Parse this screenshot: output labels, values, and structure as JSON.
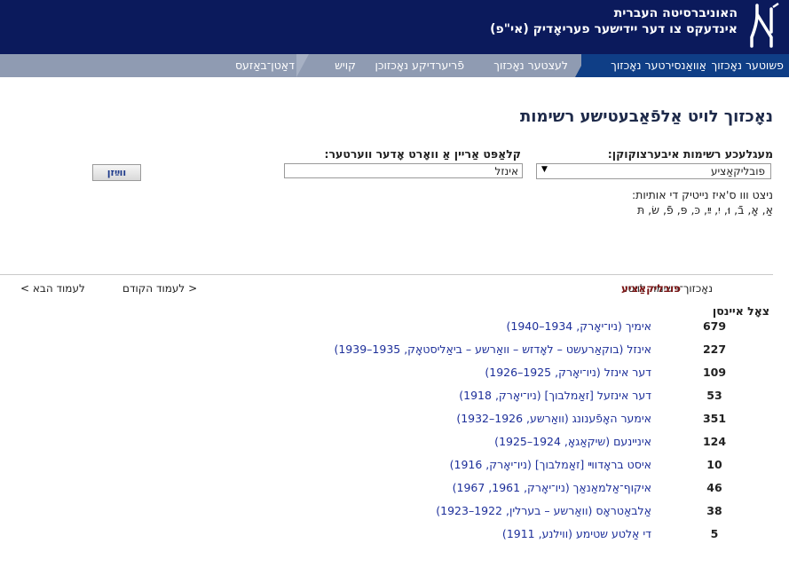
{
  "header": {
    "university": "האוניברסיטה העברית",
    "site_title": "אינדעקס צו דער יידישער פעריאָדיק (אי\"פ)"
  },
  "nav": {
    "items": [
      {
        "label": "פשוטער נאָכזוך"
      },
      {
        "label": "אַוואַנסירטער נאָכזוך"
      },
      {
        "label": "לעצטער נאָכזוך"
      },
      {
        "label": "פֿריערדיקע נאָכזוכן"
      },
      {
        "label": "קויש"
      },
      {
        "label": "דאַטן־באַזעס"
      }
    ]
  },
  "page_title": "נאָכזוך לויט אַלפֿאַבעטישע רשימות",
  "form": {
    "list_label": "מעגלעכע רשימות איבערצוקוקן:",
    "list_selected": "פובליקאַציע",
    "search_label": "קלאַפּט אַריין אַ וואָרט אָדער ווערטער:",
    "search_value": "אינזל",
    "show_button": "ווײַזן"
  },
  "hint": {
    "text": "ניצט ווו ס'איז נייטיק די אותיות:",
    "letters": "אַ, אָ, בֿ, וּ, יִ, ײַ, כּ, פּ, פֿ, שׂ, תּ"
  },
  "results_nav": {
    "current_list_label": "נאָכזוך־רשימה לויט:",
    "current_list_value": "פובליקאַציע",
    "prev": "< לעמוד הקודם",
    "next": "לעמוד הבא >"
  },
  "table": {
    "count_header": "צאָל איינסן",
    "rows": [
      {
        "count": "679",
        "entry": "אימיך (ניו־יאָרק, 1934–1940)"
      },
      {
        "count": "227",
        "entry": "אינזל (בוקאַרעשט – לאָדזש – וואַרשע – ביאַליסטאָק, 1935–1939)"
      },
      {
        "count": "109",
        "entry": "דער אינזל (ניו־יאָרק, 1925–1926)"
      },
      {
        "count": "53",
        "entry": "דער אינזעל [זאַמלבוך] (ניו־יאָרק, 1918)"
      },
      {
        "count": "351",
        "entry": "אימער האָפֿענונג (וואַרשע, 1926–1932)"
      },
      {
        "count": "124",
        "entry": "איניינעם (שיקאַגאָ, 1924–1925)"
      },
      {
        "count": "10",
        "entry": "איסט בראָדווײ [זאַמלבוך] (ניו־יאָרק, 1916)"
      },
      {
        "count": "46",
        "entry": "איקוף־אַלמאַנאַך (ניו־יאָרק, 1961, 1967)"
      },
      {
        "count": "38",
        "entry": "אַלבאַטראָס (וואַרשע – בערלין, 1922–1923)"
      },
      {
        "count": "5",
        "entry": "די אַלטע שטימע (ווילנע, 1911)"
      }
    ]
  },
  "colors": {
    "header_bg": "#0b1a5c",
    "nav_bg": "#8f9bb2",
    "nav_active_bg": "#0f3e86",
    "link": "#1d2f9a",
    "accent_text": "#7a1515"
  }
}
